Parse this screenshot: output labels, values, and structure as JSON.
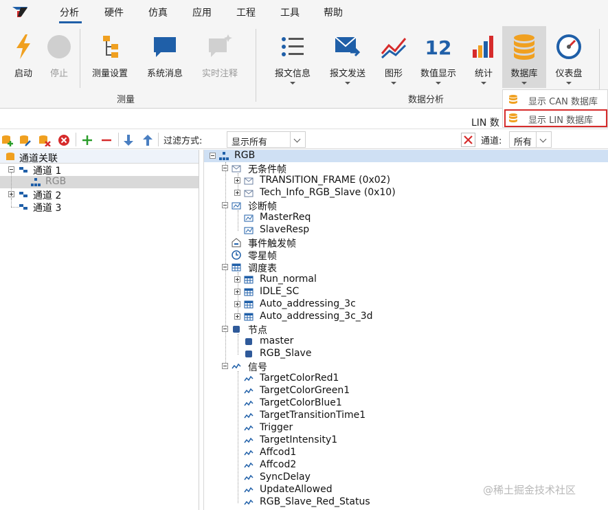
{
  "menu": {
    "tabs": [
      {
        "label": "分析",
        "active": true
      },
      {
        "label": "硬件"
      },
      {
        "label": "仿真"
      },
      {
        "label": "应用"
      },
      {
        "label": "工程"
      },
      {
        "label": "工具"
      },
      {
        "label": "帮助"
      }
    ]
  },
  "ribbon": {
    "start": "启动",
    "stop": "停止",
    "measure_setup": "测量设置",
    "system_messages": "系统消息",
    "realtime_annotation": "实时注释",
    "group_measure": "测量",
    "message_info": "报文信息",
    "message_send": "报文发送",
    "graphics": "图形",
    "numeric_display": "数值显示",
    "numeric_icon_text": "12",
    "statistics": "统计",
    "database": "数据库",
    "dashboard": "仪表盘",
    "group_analysis": "数据分析"
  },
  "dropdown": {
    "show_can": "显示 CAN 数据库",
    "show_lin": "显示 LIN 数据库"
  },
  "strip_text": "LIN 数",
  "toolbar": {
    "filter_label": "过滤方式:",
    "filter_value": "显示所有",
    "channel_label": "通道:",
    "channel_value": "所有"
  },
  "left_tree": {
    "header": "通道关联",
    "items": [
      "通道 1",
      "RGB",
      "通道 2",
      "通道 3"
    ]
  },
  "right_tree": {
    "root": "RGB",
    "unconditional": "无条件帧",
    "frames": [
      "TRANSITION_FRAME (0x02)",
      "Tech_Info_RGB_Slave (0x10)"
    ],
    "diagnostic": "诊断帧",
    "diag_frames": [
      "MasterReq",
      "SlaveResp"
    ],
    "event_triggered": "事件触发帧",
    "sporadic": "零星帧",
    "schedule": "调度表",
    "schedules": [
      "Run_normal",
      "IDLE_SC",
      "Auto_addressing_3c",
      "Auto_addressing_3c_3d"
    ],
    "nodes": "节点",
    "node_items": [
      "master",
      "RGB_Slave"
    ],
    "signals": "信号",
    "signal_items": [
      "TargetColorRed1",
      "TargetColorGreen1",
      "TargetColorBlue1",
      "TargetTransitionTime1",
      "Trigger",
      "TargetIntensity1",
      "Affcod1",
      "Affcod2",
      "SyncDelay",
      "UpdateAllowed",
      "RGB_Slave_Red_Status"
    ]
  },
  "watermark": "@稀土掘金技术社区",
  "colors": {
    "accent": "#1f5fa8",
    "highlight_border": "#d62b2b",
    "database_orange": "#f0a020"
  }
}
